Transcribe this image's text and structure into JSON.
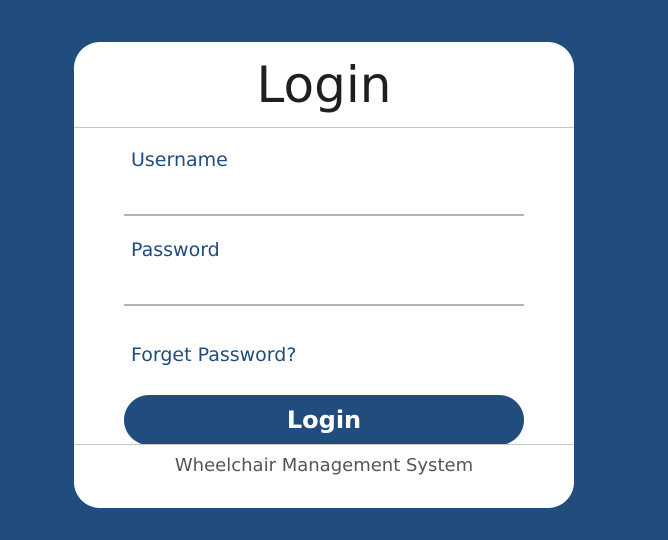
{
  "colors": {
    "background": "#214c7e",
    "card": "#ffffff",
    "accent": "#214c7e",
    "title_text": "#1f1f1f",
    "footer_text": "#555555",
    "divider": "#c7c7c7"
  },
  "login": {
    "title": "Login",
    "username": {
      "label": "Username",
      "value": "",
      "placeholder": ""
    },
    "password": {
      "label": "Password",
      "value": "",
      "placeholder": ""
    },
    "forgot_link": "Forget Password?",
    "submit_label": "Login"
  },
  "footer": {
    "text": "Wheelchair Management System"
  }
}
